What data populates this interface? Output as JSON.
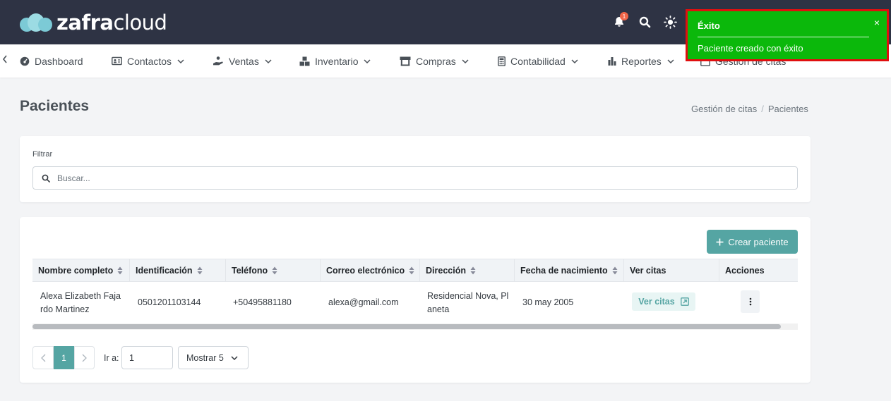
{
  "brand": {
    "name_bold": "zafra",
    "name_light": "cloud"
  },
  "header": {
    "notification_count": "1"
  },
  "nav": {
    "items": [
      {
        "label": "Dashboard"
      },
      {
        "label": "Contactos"
      },
      {
        "label": "Ventas"
      },
      {
        "label": "Inventario"
      },
      {
        "label": "Compras"
      },
      {
        "label": "Contabilidad"
      },
      {
        "label": "Reportes"
      },
      {
        "label": "Gestión de citas"
      }
    ]
  },
  "toast": {
    "title": "Éxito",
    "message": "Paciente creado con éxito",
    "close": "×"
  },
  "page": {
    "title": "Pacientes",
    "breadcrumb": [
      "Gestión de citas",
      "Pacientes"
    ]
  },
  "filter": {
    "label": "Filtrar",
    "search_placeholder": "Buscar..."
  },
  "table": {
    "create_button": "Crear paciente",
    "columns": [
      "Nombre completo",
      "Identificación",
      "Teléfono",
      "Correo electrónico",
      "Dirección",
      "Fecha de nacimiento",
      "Ver citas",
      "Acciones"
    ],
    "rows": [
      {
        "name_line1": "Alexa Elizabeth Faja",
        "name_line2": "rdo Martinez",
        "id": "0501201103144",
        "phone": "+50495881180",
        "email": "alexa@gmail.com",
        "address_line1": "Residencial Nova, Pl",
        "address_line2": "aneta",
        "birthdate": "30 may 2005",
        "ver_citas": "Ver citas"
      }
    ]
  },
  "pagination": {
    "current_page": "1",
    "goto_label": "Ir a:",
    "goto_value": "1",
    "page_size": "Mostrar 5"
  },
  "colors": {
    "header_bg": "#2e3344",
    "accent": "#55a5a3",
    "toast_bg": "#0bb80b",
    "toast_border": "#e00f0f"
  }
}
